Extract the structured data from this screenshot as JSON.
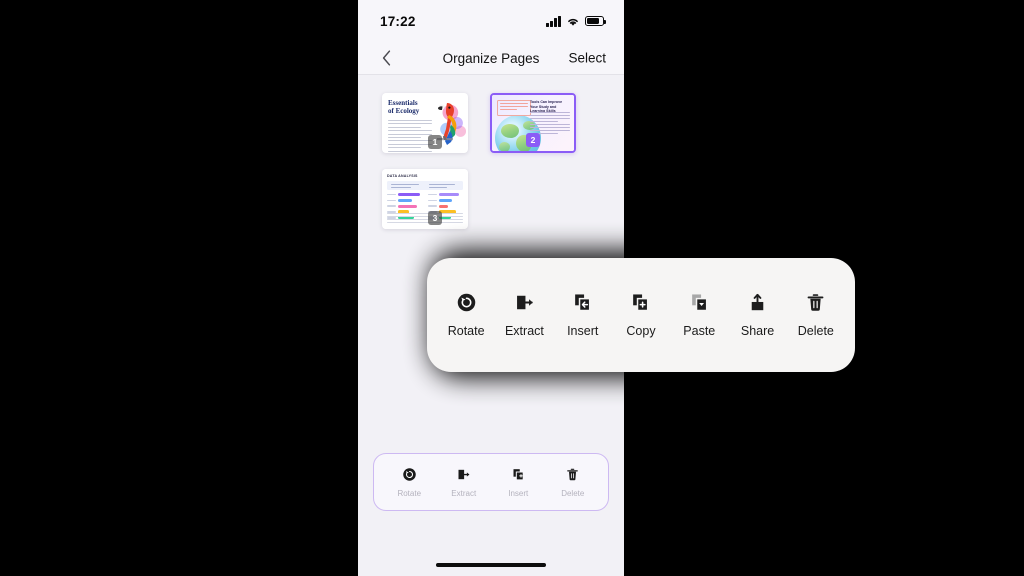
{
  "status_bar": {
    "time": "17:22",
    "signal_icon": "cellular-signal-icon",
    "wifi_icon": "wifi-icon",
    "battery_icon": "battery-icon"
  },
  "nav_bar": {
    "back_icon": "chevron-left-icon",
    "title": "Organize Pages",
    "select_label": "Select"
  },
  "pages": [
    {
      "number": "1",
      "selected": false,
      "title": "Essentials\nof Ecology",
      "title_line1": "Essentials",
      "title_line2": "of Ecology",
      "art": "parrot-illustration"
    },
    {
      "number": "2",
      "selected": true,
      "heading": "Tools Can Improve Your Study and Learning Skills",
      "art": "globe-illustration"
    },
    {
      "number": "3",
      "selected": false,
      "title": "DATA ANALYSIS",
      "art": "data-table-chart"
    }
  ],
  "context_menu": {
    "items": [
      {
        "label": "Rotate",
        "icon": "rotate-icon",
        "disabled": false
      },
      {
        "label": "Extract",
        "icon": "extract-icon",
        "disabled": false
      },
      {
        "label": "Insert",
        "icon": "insert-icon",
        "disabled": false
      },
      {
        "label": "Copy",
        "icon": "copy-icon",
        "disabled": false
      },
      {
        "label": "Paste",
        "icon": "paste-icon",
        "disabled": true
      },
      {
        "label": "Share",
        "icon": "share-icon",
        "disabled": false
      },
      {
        "label": "Delete",
        "icon": "delete-icon",
        "disabled": false
      }
    ]
  },
  "bottom_toolbar": {
    "items": [
      {
        "label": "Rotate",
        "icon": "rotate-icon"
      },
      {
        "label": "Extract",
        "icon": "extract-icon"
      },
      {
        "label": "Insert",
        "icon": "insert-icon"
      },
      {
        "label": "Delete",
        "icon": "delete-icon"
      }
    ]
  },
  "annotation": {
    "arrow_icon": "curved-arrow-annotation",
    "color": "#a371f7"
  },
  "colors": {
    "accent_purple": "#8b5cf6",
    "app_background": "#f2f1f6",
    "bar_background": "#f7f6fa",
    "menu_background": "#f6f5f4",
    "toolbar_border": "#cdb9f2",
    "disabled_text": "#b4b2bd"
  }
}
